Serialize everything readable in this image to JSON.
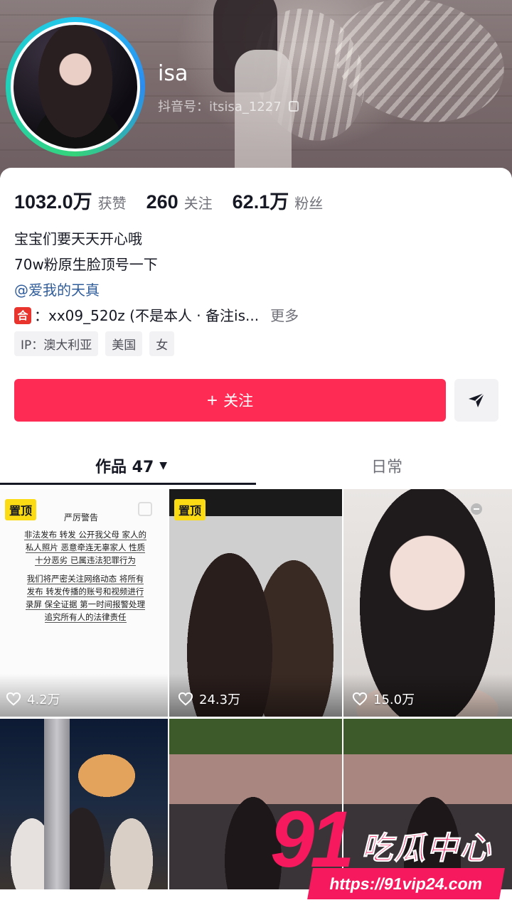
{
  "profile": {
    "nickname": "isa",
    "douyin_id": "抖音号：itsisa_1227"
  },
  "stats": [
    {
      "value": "1032.0万",
      "label": "获赞"
    },
    {
      "value": "260",
      "label": "关注"
    },
    {
      "value": "62.1万",
      "label": "粉丝"
    }
  ],
  "bio": {
    "line1": "宝宝们要天天开心哦",
    "line2": "70w粉原生脸顶号一下",
    "mention": "@爱我的天真",
    "he_icon": "合",
    "contact": "：xx09_520z (不是本人 · 备注is...",
    "more": "更多"
  },
  "tags": [
    "IP：澳大利亚",
    "美国",
    "女"
  ],
  "actions": {
    "follow_plus": "+",
    "follow_label": "关注"
  },
  "tabs": {
    "works": "作品 47",
    "daily": "日常"
  },
  "grid": {
    "pinned_label": "置顶",
    "warning": {
      "title": "严厉警告",
      "line1": "非法发布 转发 公开我父母 家人的",
      "line2": "私人照片 恶意牵连无辜家人 性质",
      "line3": "十分恶劣 已属违法犯罪行为",
      "line4": "我们将严密关注网络动态 将所有",
      "line5": "发布 转发传播的账号和视频进行",
      "line6": "录屏 保全证据 第一时间报警处理",
      "line7": "追究所有人的法律责任"
    },
    "likes": [
      "4.2万",
      "24.3万",
      "15.0万"
    ]
  },
  "watermark": {
    "brand_num": "91",
    "brand_text": "吃瓜中心",
    "url": "https://91vip24.com"
  },
  "colors": {
    "accent": "#fe2c55",
    "pinned": "#fadb14",
    "mention": "#2f5c9a",
    "watermark": "#f7195e"
  }
}
